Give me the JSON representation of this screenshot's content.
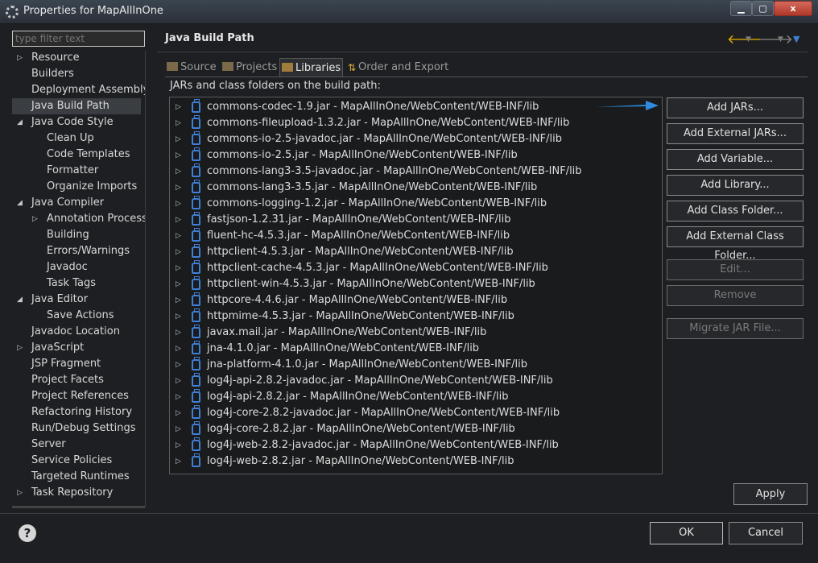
{
  "window": {
    "title": "Properties for MapAllInOne",
    "close_glyph": "x"
  },
  "filter": {
    "placeholder": "type filter text"
  },
  "nav": [
    {
      "label": "Resource",
      "expandable": true
    },
    {
      "label": "Builders"
    },
    {
      "label": "Deployment Assembly"
    },
    {
      "label": "Java Build Path",
      "selected": true
    },
    {
      "label": "Java Code Style",
      "expanded": true
    },
    {
      "label": "Clean Up",
      "child": true
    },
    {
      "label": "Code Templates",
      "child": true
    },
    {
      "label": "Formatter",
      "child": true
    },
    {
      "label": "Organize Imports",
      "child": true
    },
    {
      "label": "Java Compiler",
      "expanded": true
    },
    {
      "label": "Annotation Processi",
      "child": true,
      "expandable": true
    },
    {
      "label": "Building",
      "child": true
    },
    {
      "label": "Errors/Warnings",
      "child": true
    },
    {
      "label": "Javadoc",
      "child": true
    },
    {
      "label": "Task Tags",
      "child": true
    },
    {
      "label": "Java Editor",
      "expanded": true
    },
    {
      "label": "Save Actions",
      "child": true
    },
    {
      "label": "Javadoc Location"
    },
    {
      "label": "JavaScript",
      "expandable": true
    },
    {
      "label": "JSP Fragment"
    },
    {
      "label": "Project Facets"
    },
    {
      "label": "Project References"
    },
    {
      "label": "Refactoring History"
    },
    {
      "label": "Run/Debug Settings"
    },
    {
      "label": "Server"
    },
    {
      "label": "Service Policies"
    },
    {
      "label": "Targeted Runtimes"
    },
    {
      "label": "Task Repository",
      "expandable": true
    }
  ],
  "page": {
    "title": "Java Build Path",
    "description": "JARs and class folders on the build path:"
  },
  "tabs": [
    {
      "label": "Source"
    },
    {
      "label": "Projects"
    },
    {
      "label": "Libraries",
      "active": true
    },
    {
      "label": "Order and Export"
    }
  ],
  "libraries": [
    "commons-codec-1.9.jar - MapAllInOne/WebContent/WEB-INF/lib",
    "commons-fileupload-1.3.2.jar - MapAllInOne/WebContent/WEB-INF/lib",
    "commons-io-2.5-javadoc.jar - MapAllInOne/WebContent/WEB-INF/lib",
    "commons-io-2.5.jar - MapAllInOne/WebContent/WEB-INF/lib",
    "commons-lang3-3.5-javadoc.jar - MapAllInOne/WebContent/WEB-INF/lib",
    "commons-lang3-3.5.jar - MapAllInOne/WebContent/WEB-INF/lib",
    "commons-logging-1.2.jar - MapAllInOne/WebContent/WEB-INF/lib",
    "fastjson-1.2.31.jar - MapAllInOne/WebContent/WEB-INF/lib",
    "fluent-hc-4.5.3.jar - MapAllInOne/WebContent/WEB-INF/lib",
    "httpclient-4.5.3.jar - MapAllInOne/WebContent/WEB-INF/lib",
    "httpclient-cache-4.5.3.jar - MapAllInOne/WebContent/WEB-INF/lib",
    "httpclient-win-4.5.3.jar - MapAllInOne/WebContent/WEB-INF/lib",
    "httpcore-4.4.6.jar - MapAllInOne/WebContent/WEB-INF/lib",
    "httpmime-4.5.3.jar - MapAllInOne/WebContent/WEB-INF/lib",
    "javax.mail.jar - MapAllInOne/WebContent/WEB-INF/lib",
    "jna-4.1.0.jar - MapAllInOne/WebContent/WEB-INF/lib",
    "jna-platform-4.1.0.jar - MapAllInOne/WebContent/WEB-INF/lib",
    "log4j-api-2.8.2-javadoc.jar - MapAllInOne/WebContent/WEB-INF/lib",
    "log4j-api-2.8.2.jar - MapAllInOne/WebContent/WEB-INF/lib",
    "log4j-core-2.8.2-javadoc.jar - MapAllInOne/WebContent/WEB-INF/lib",
    "log4j-core-2.8.2.jar - MapAllInOne/WebContent/WEB-INF/lib",
    "log4j-web-2.8.2-javadoc.jar - MapAllInOne/WebContent/WEB-INF/lib",
    "log4j-web-2.8.2.jar - MapAllInOne/WebContent/WEB-INF/lib"
  ],
  "buttons": {
    "add_jars": "Add JARs...",
    "add_external_jars": "Add External JARs...",
    "add_variable": "Add Variable...",
    "add_library": "Add Library...",
    "add_class_folder": "Add Class Folder...",
    "add_external_class_folder": "Add External Class Folder...",
    "edit": "Edit...",
    "remove": "Remove",
    "migrate": "Migrate JAR File...",
    "apply": "Apply",
    "ok": "OK",
    "cancel": "Cancel"
  },
  "help_glyph": "?",
  "colors": {
    "accent_blue": "#3f7fd6",
    "arrow_blue": "#2f8be0",
    "back_arrow": "#e8b400"
  }
}
